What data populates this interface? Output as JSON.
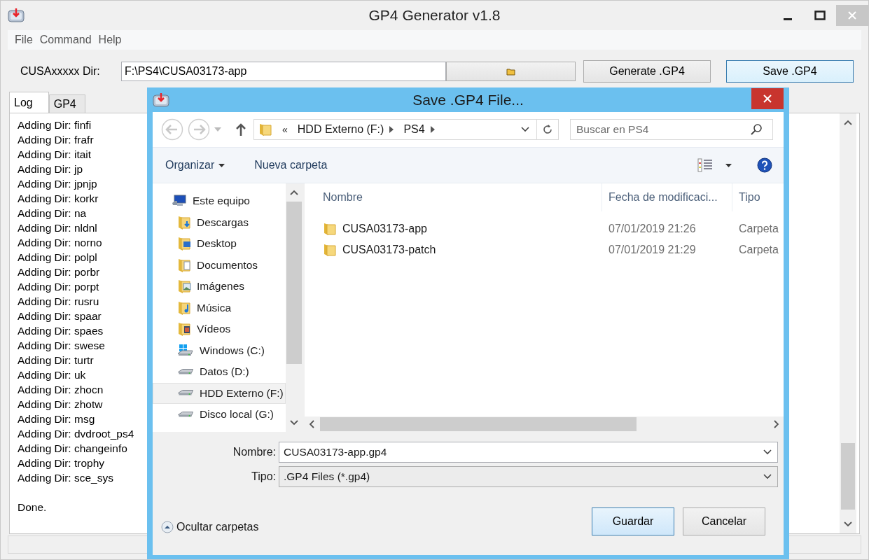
{
  "window": {
    "title": "GP4 Generator v1.8"
  },
  "menu": [
    "File",
    "Command",
    "Help"
  ],
  "dir": {
    "label": "CUSAxxxxx Dir:",
    "value": "F:\\PS4\\CUSA03173-app"
  },
  "buttons": [
    {
      "label": "Generate .GP4",
      "focused": false
    },
    {
      "label": "Save .GP4",
      "focused": true
    }
  ],
  "tabs": [
    {
      "label": "Log",
      "selected": true
    },
    {
      "label": "GP4",
      "selected": false
    }
  ],
  "log": [
    "Adding Dir: finfi",
    "Adding Dir: frafr",
    "Adding Dir: itait",
    "Adding Dir: jp",
    "Adding Dir: jpnjp",
    "Adding Dir: korkr",
    "Adding Dir: na",
    "Adding Dir: nldnl",
    "Adding Dir: norno",
    "Adding Dir: polpl",
    "Adding Dir: porbr",
    "Adding Dir: porpt",
    "Adding Dir: rusru",
    "Adding Dir: spaar",
    "Adding Dir: spaes",
    "Adding Dir: swese",
    "Adding Dir: turtr",
    "Adding Dir: uk",
    "Adding Dir: zhocn",
    "Adding Dir: zhotw",
    "Adding Dir: msg",
    "Adding Dir: dvdroot_ps4",
    "Adding Dir: changeinfo",
    "Adding Dir: trophy",
    "Adding Dir: sce_sys"
  ],
  "log_summary": "Done.",
  "dialog": {
    "title": "Save .GP4 File...",
    "breadcrumb_overflow": "«",
    "breadcrumb": [
      "HDD Externo (F:)",
      "PS4"
    ],
    "search": {
      "placeholder": "Buscar en PS4"
    },
    "toolbar": [
      "Organizar",
      "Nueva carpeta"
    ],
    "nav": [
      {
        "label": "Este equipo",
        "kind": "computer",
        "selected": false,
        "children": [
          {
            "label": "Descargas",
            "kind": "downloads",
            "selected": false
          },
          {
            "label": "Desktop",
            "kind": "desktop",
            "selected": false
          },
          {
            "label": "Documentos",
            "kind": "documents",
            "selected": false
          },
          {
            "label": "Imágenes",
            "kind": "pictures",
            "selected": false
          },
          {
            "label": "Música",
            "kind": "music",
            "selected": false
          },
          {
            "label": "Vídeos",
            "kind": "videos",
            "selected": false
          },
          {
            "label": "Windows (C:)",
            "kind": "system-drive",
            "selected": false
          },
          {
            "label": "Datos (D:)",
            "kind": "drive",
            "selected": false
          },
          {
            "label": "HDD Externo (F:)",
            "kind": "drive",
            "selected": true
          },
          {
            "label": "Disco local (G:)",
            "kind": "drive",
            "selected": false
          }
        ]
      }
    ],
    "columns": [
      "Nombre",
      "Fecha de modificaci...",
      "Tipo"
    ],
    "rows": [
      {
        "name": "CUSA03173-app",
        "date": "07/01/2019 21:26",
        "type": "Carpeta"
      },
      {
        "name": "CUSA03173-patch",
        "date": "07/01/2019 21:29",
        "type": "Carpeta"
      }
    ],
    "file_name": {
      "label": "Nombre:",
      "value": "CUSA03173-app.gp4"
    },
    "file_type": {
      "label": "Tipo:",
      "value": ".GP4 Files (*.gp4)"
    },
    "hide_folders": "Ocultar carpetas",
    "buttons": [
      {
        "label": "Guardar",
        "default": true
      },
      {
        "label": "Cancelar",
        "default": false
      }
    ]
  }
}
